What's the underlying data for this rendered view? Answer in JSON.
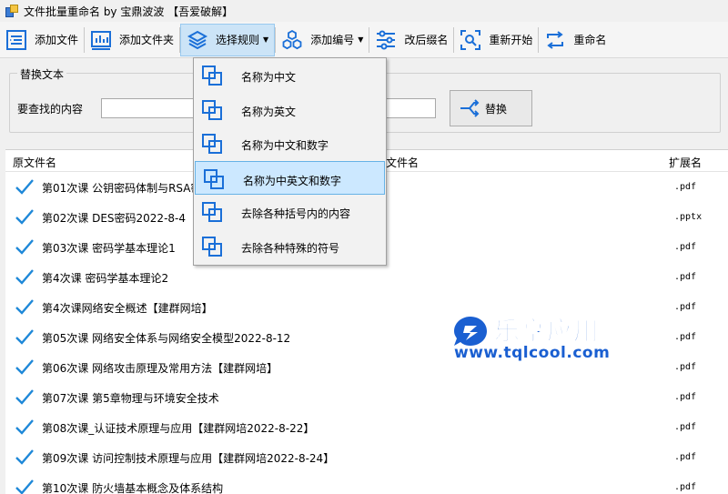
{
  "window": {
    "title": "文件批量重命名 by 宝鼎波波 【吾爱破解】"
  },
  "toolbar": {
    "add_file": "添加文件",
    "add_folder": "添加文件夹",
    "select_rule": "选择规则",
    "add_number": "添加编号",
    "change_ext": "改后缀名",
    "restart": "重新开始",
    "rename": "重命名"
  },
  "replace": {
    "legend": "替换文本",
    "find_label": "要查找的内容",
    "find_value": "",
    "replace_value": "",
    "button": "替换"
  },
  "rule_menu": {
    "items": [
      "名称为中文",
      "名称为英文",
      "名称为中文和数字",
      "名称为中英文和数字",
      "去除各种括号内的内容",
      "去除各种特殊的符号"
    ]
  },
  "file_list": {
    "headers": {
      "original": "原文件名",
      "new": "文件名",
      "ext": "扩展名"
    },
    "rows": [
      {
        "name": "第01次课 公钥密码体制与RSA密",
        "ext": ".pdf"
      },
      {
        "name": "第02次课 DES密码2022-8-4",
        "ext": ".pptx"
      },
      {
        "name": "第03次课 密码学基本理论1",
        "ext": ".pdf"
      },
      {
        "name": "第4次课 密码学基本理论2",
        "ext": ".pdf"
      },
      {
        "name": "第4次课网络安全概述【建群网培】",
        "ext": ".pdf"
      },
      {
        "name": "第05次课 网络安全体系与网络安全模型2022-8-12",
        "ext": ".pdf"
      },
      {
        "name": "第06次课 网络攻击原理及常用方法【建群网培】",
        "ext": ".pdf"
      },
      {
        "name": "第07次课 第5章物理与环境安全技术",
        "ext": ".pdf"
      },
      {
        "name": "第08次课_认证技术原理与应用【建群网培2022-8-22】",
        "ext": ".pdf"
      },
      {
        "name": "第09次课 访问控制技术原理与应用【建群网培2022-8-24】",
        "ext": ".pdf"
      },
      {
        "name": "第10次课 防火墙基本概念及体系结构",
        "ext": ".pdf"
      }
    ]
  },
  "watermark": {
    "brand": "乐享应用",
    "url": "www.tqlcool.com"
  },
  "colors": {
    "accent": "#1a6fd8",
    "check": "#1e88d8",
    "menu_highlight": "#cce8ff"
  }
}
